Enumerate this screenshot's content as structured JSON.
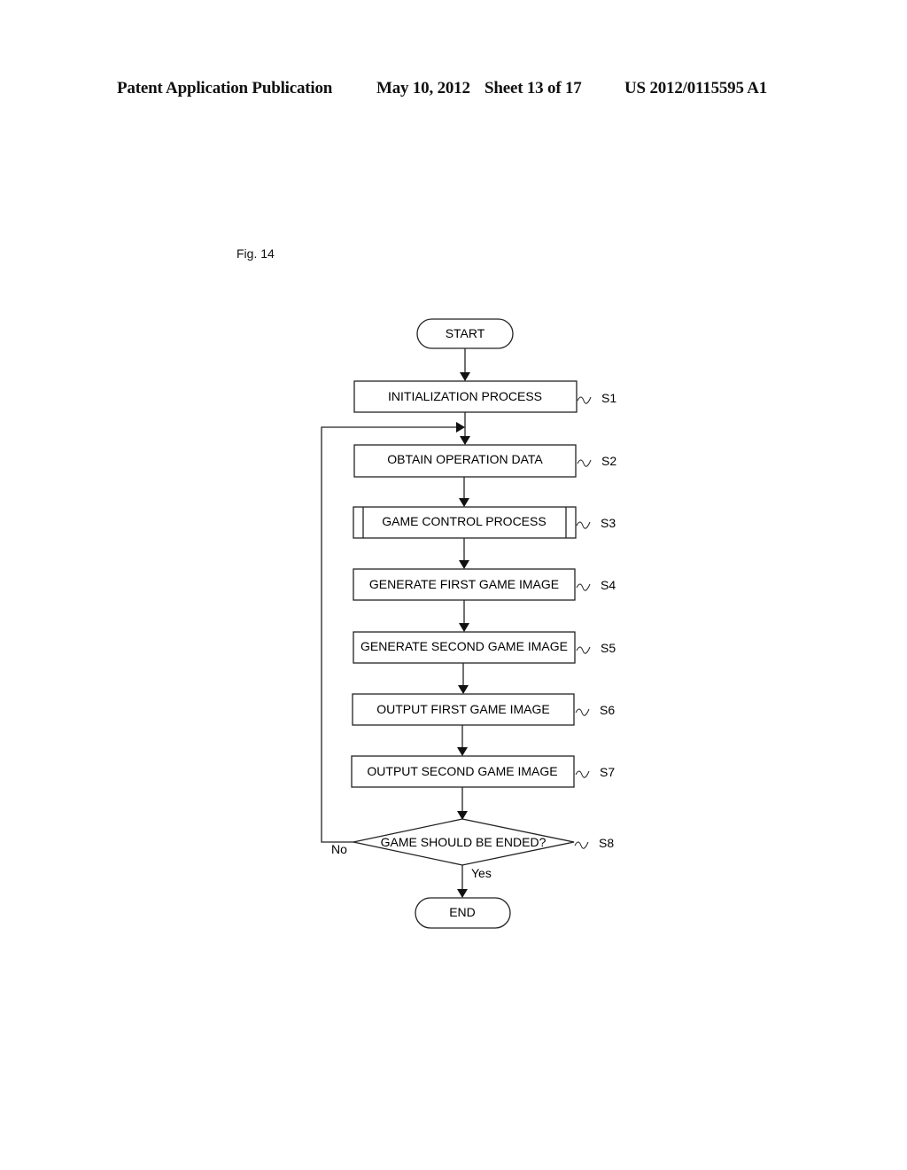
{
  "header": {
    "publication": "Patent Application Publication",
    "date": "May 10, 2012",
    "sheet": "Sheet 13 of 17",
    "number": "US 2012/0115595 A1"
  },
  "figure_label": "Fig. 14",
  "flowchart": {
    "start": "START",
    "end": "END",
    "steps": [
      {
        "id": "S1",
        "text": "INITIALIZATION PROCESS",
        "type": "process"
      },
      {
        "id": "S2",
        "text": "OBTAIN OPERATION DATA",
        "type": "process"
      },
      {
        "id": "S3",
        "text": "GAME CONTROL PROCESS",
        "type": "subroutine"
      },
      {
        "id": "S4",
        "text": "GENERATE FIRST GAME IMAGE",
        "type": "process"
      },
      {
        "id": "S5",
        "text": "GENERATE SECOND GAME IMAGE",
        "type": "process"
      },
      {
        "id": "S6",
        "text": "OUTPUT FIRST GAME IMAGE",
        "type": "process"
      },
      {
        "id": "S7",
        "text": "OUTPUT SECOND GAME IMAGE",
        "type": "process"
      }
    ],
    "decision": {
      "id": "S8",
      "text": "GAME SHOULD BE ENDED?",
      "yes": "Yes",
      "no": "No"
    }
  }
}
